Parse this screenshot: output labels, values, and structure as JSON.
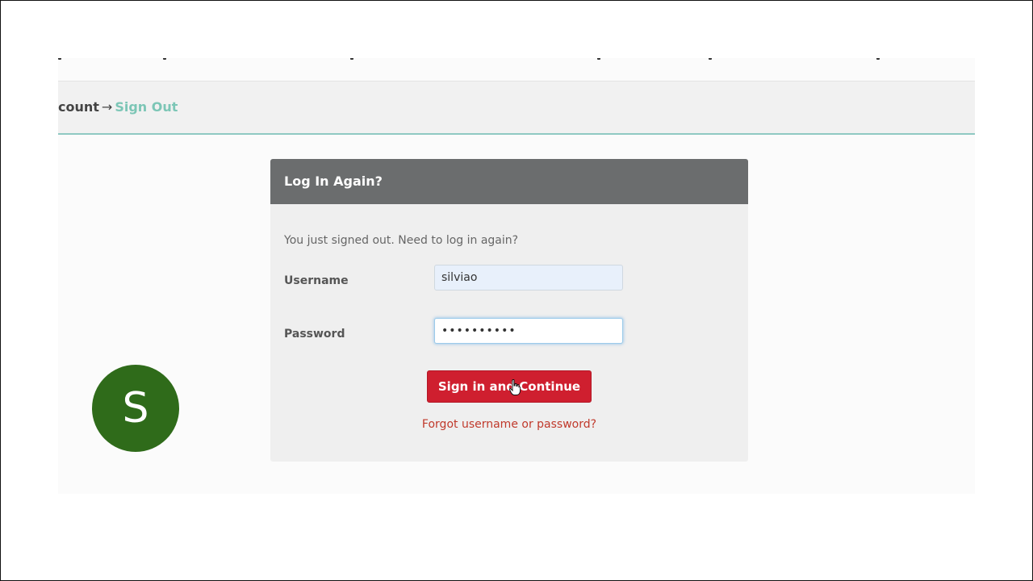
{
  "breadcrumb": {
    "previous": "count",
    "separator": "→",
    "current": "Sign Out"
  },
  "login_card": {
    "title": "Log In Again?",
    "message": "You just signed out. Need to log in again?",
    "username_label": "Username",
    "username_value": "silviao",
    "password_label": "Password",
    "password_value": "••••••••••",
    "submit_label": "Sign in and Continue",
    "forgot_link": "Forgot username or password?"
  },
  "avatar": {
    "initial": "S",
    "color": "#2f6b1a"
  },
  "colors": {
    "header_bg": "#6b6d6e",
    "button_bg": "#cf1f2f",
    "link": "#c0392b",
    "breadcrumb_accent": "#7cc6b6"
  },
  "icons": {
    "cursor": "hand-pointer-icon"
  }
}
